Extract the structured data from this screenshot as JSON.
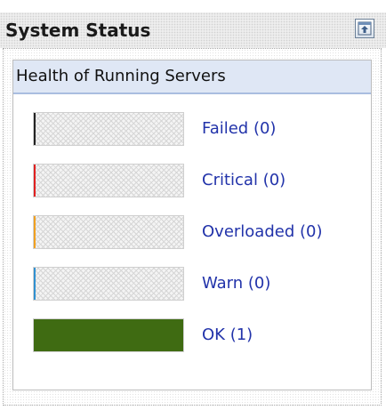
{
  "portlet": {
    "title": "System Status",
    "maximize_icon": "maximize-icon"
  },
  "health": {
    "title": "Health of Running Servers",
    "rows": [
      {
        "key": "failed",
        "label": "Failed (0)",
        "count": 0,
        "fill_fraction": 0,
        "color": "#222222"
      },
      {
        "key": "critical",
        "label": "Critical (0)",
        "count": 0,
        "fill_fraction": 0,
        "color": "#e02020"
      },
      {
        "key": "overloaded",
        "label": "Overloaded (0)",
        "count": 0,
        "fill_fraction": 0,
        "color": "#f0a020"
      },
      {
        "key": "warn",
        "label": "Warn (0)",
        "count": 0,
        "fill_fraction": 0,
        "color": "#3090d0"
      },
      {
        "key": "ok",
        "label": "OK (1)",
        "count": 1,
        "fill_fraction": 1,
        "color": "#3f6b12"
      }
    ]
  }
}
